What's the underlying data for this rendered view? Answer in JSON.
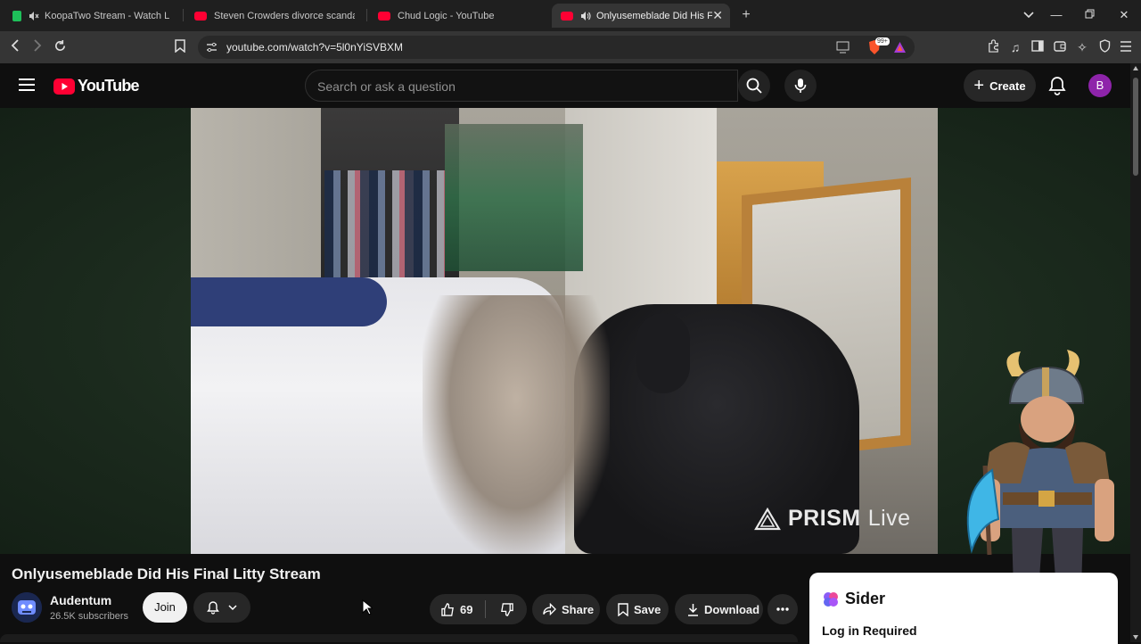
{
  "browser": {
    "tabs": [
      {
        "title": "KoopaTwo Stream - Watch Live o",
        "icon_color": "#23c55e",
        "muted": true,
        "active": false
      },
      {
        "title": "Steven Crowders divorce scandal | RE",
        "icon_color": "#ff0033",
        "muted": false,
        "active": false
      },
      {
        "title": "Chud Logic - YouTube",
        "icon_color": "#ff0033",
        "muted": false,
        "active": false
      },
      {
        "title": "Onlyusemeblade Did His Fina",
        "icon_color": "#ff0033",
        "muted": false,
        "active": true,
        "audio": true
      }
    ],
    "url": "youtube.com/watch?v=5l0nYiSVBXM",
    "brave_badge": "99+"
  },
  "youtube": {
    "logo_text": "YouTube",
    "search_placeholder": "Search or ask a question",
    "create_label": "Create",
    "avatar_letter": "B"
  },
  "video": {
    "overlay_brand": "PRISM",
    "overlay_suffix": "Live"
  },
  "meta": {
    "title": "Onlyusemeblade Did His Final Litty Stream",
    "channel_name": "Audentum",
    "subscribers": "26.5K subscribers",
    "join_label": "Join",
    "like_count": "69",
    "share_label": "Share",
    "save_label": "Save",
    "download_label": "Download"
  },
  "sider": {
    "brand": "Sider",
    "login_text": "Log in Required"
  },
  "colors": {
    "yt_red": "#ff0033",
    "background": "#0f0f0f",
    "pill_bg": "#272727",
    "avatar": "#8e24aa"
  }
}
